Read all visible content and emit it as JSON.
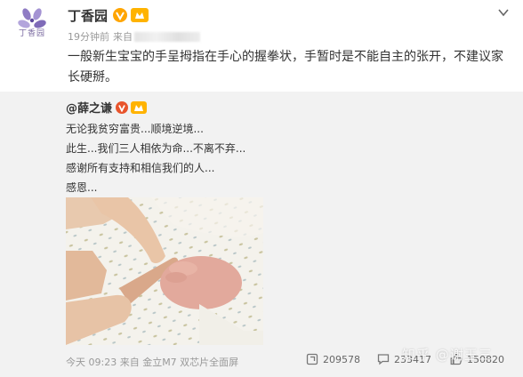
{
  "post": {
    "author": "丁香园",
    "logo_text": "丁香园",
    "time": "19分钟前",
    "source_prefix": "来自",
    "text": "一般新生宝宝的手呈拇指在手心的握拳状，手暂时是不能自主的张开，不建议家长硬掰。"
  },
  "repost": {
    "author": "@薛之谦",
    "lines": [
      "无论我贫穷富贵...顺境逆境...",
      "此生...我们三人相依为命...不离不弃...",
      "感谢所有支持和相信我们的人...",
      "感恩..."
    ],
    "footer": "今天 09:23 来自 金立M7 双芯片全面屏",
    "stats": {
      "reposts": "209578",
      "comments": "233417",
      "likes": "150820"
    }
  },
  "watermark": "知乎 @谢玉三",
  "colors": {
    "verified_badge": "#ffa500",
    "repost_bg": "#f2f2f2",
    "muted_text": "#999999"
  },
  "icons": [
    "lilac-logo",
    "verified-icon",
    "level-icon",
    "dropdown-caret-icon",
    "repost-icon",
    "comment-icon",
    "like-icon"
  ]
}
